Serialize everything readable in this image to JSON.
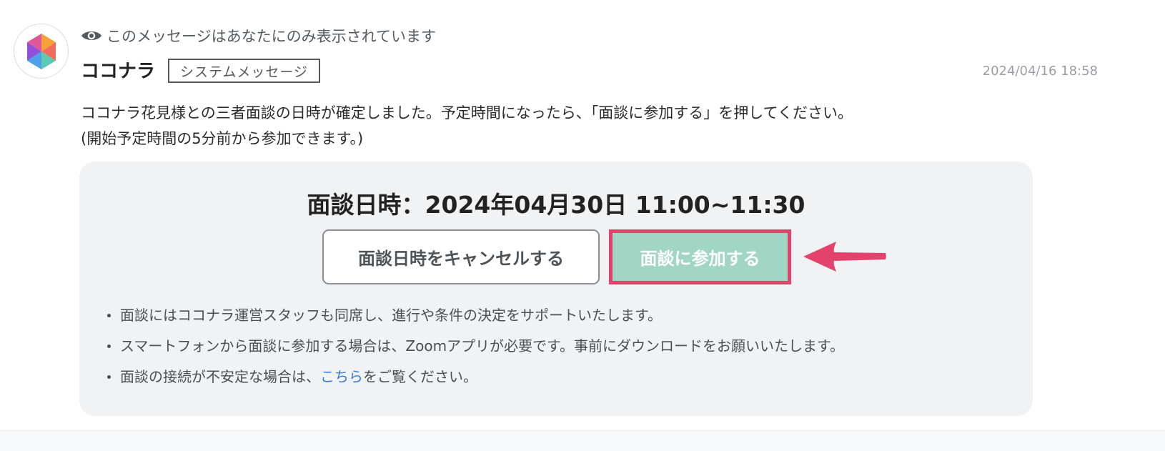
{
  "visibility_note": "このメッセージはあなたにのみ表示されています",
  "sender": {
    "name": "ココナラ",
    "badge": "システムメッセージ",
    "avatar_icon": "coconala-logo-icon"
  },
  "timestamp": "2024/04/16 18:58",
  "message": {
    "line1": "ココナラ花見様との三者面談の日時が確定しました。予定時間になったら、「面談に参加する」を押してください。",
    "line2": "(開始予定時間の5分前から参加できます。)"
  },
  "card": {
    "datetime": "面談日時：2024年04月30日 11:00~11:30",
    "cancel_button": "面談日時をキャンセルする",
    "join_button": "面談に参加する",
    "notes": [
      "面談にはココナラ運営スタッフも同席し、進行や条件の決定をサポートいたします。",
      "スマートフォンから面談に参加する場合は、Zoomアプリが必要です。事前にダウンロードをお願いいたします。"
    ],
    "note3_prefix": "面談の接続が不安定な場合は、",
    "note3_link": "こちら",
    "note3_suffix": "をご覧ください。"
  },
  "colors": {
    "join_button_bg": "#a1d6c4",
    "highlight": "#e2426b",
    "link": "#3a7cd8",
    "card_bg": "#f1f2f3"
  }
}
